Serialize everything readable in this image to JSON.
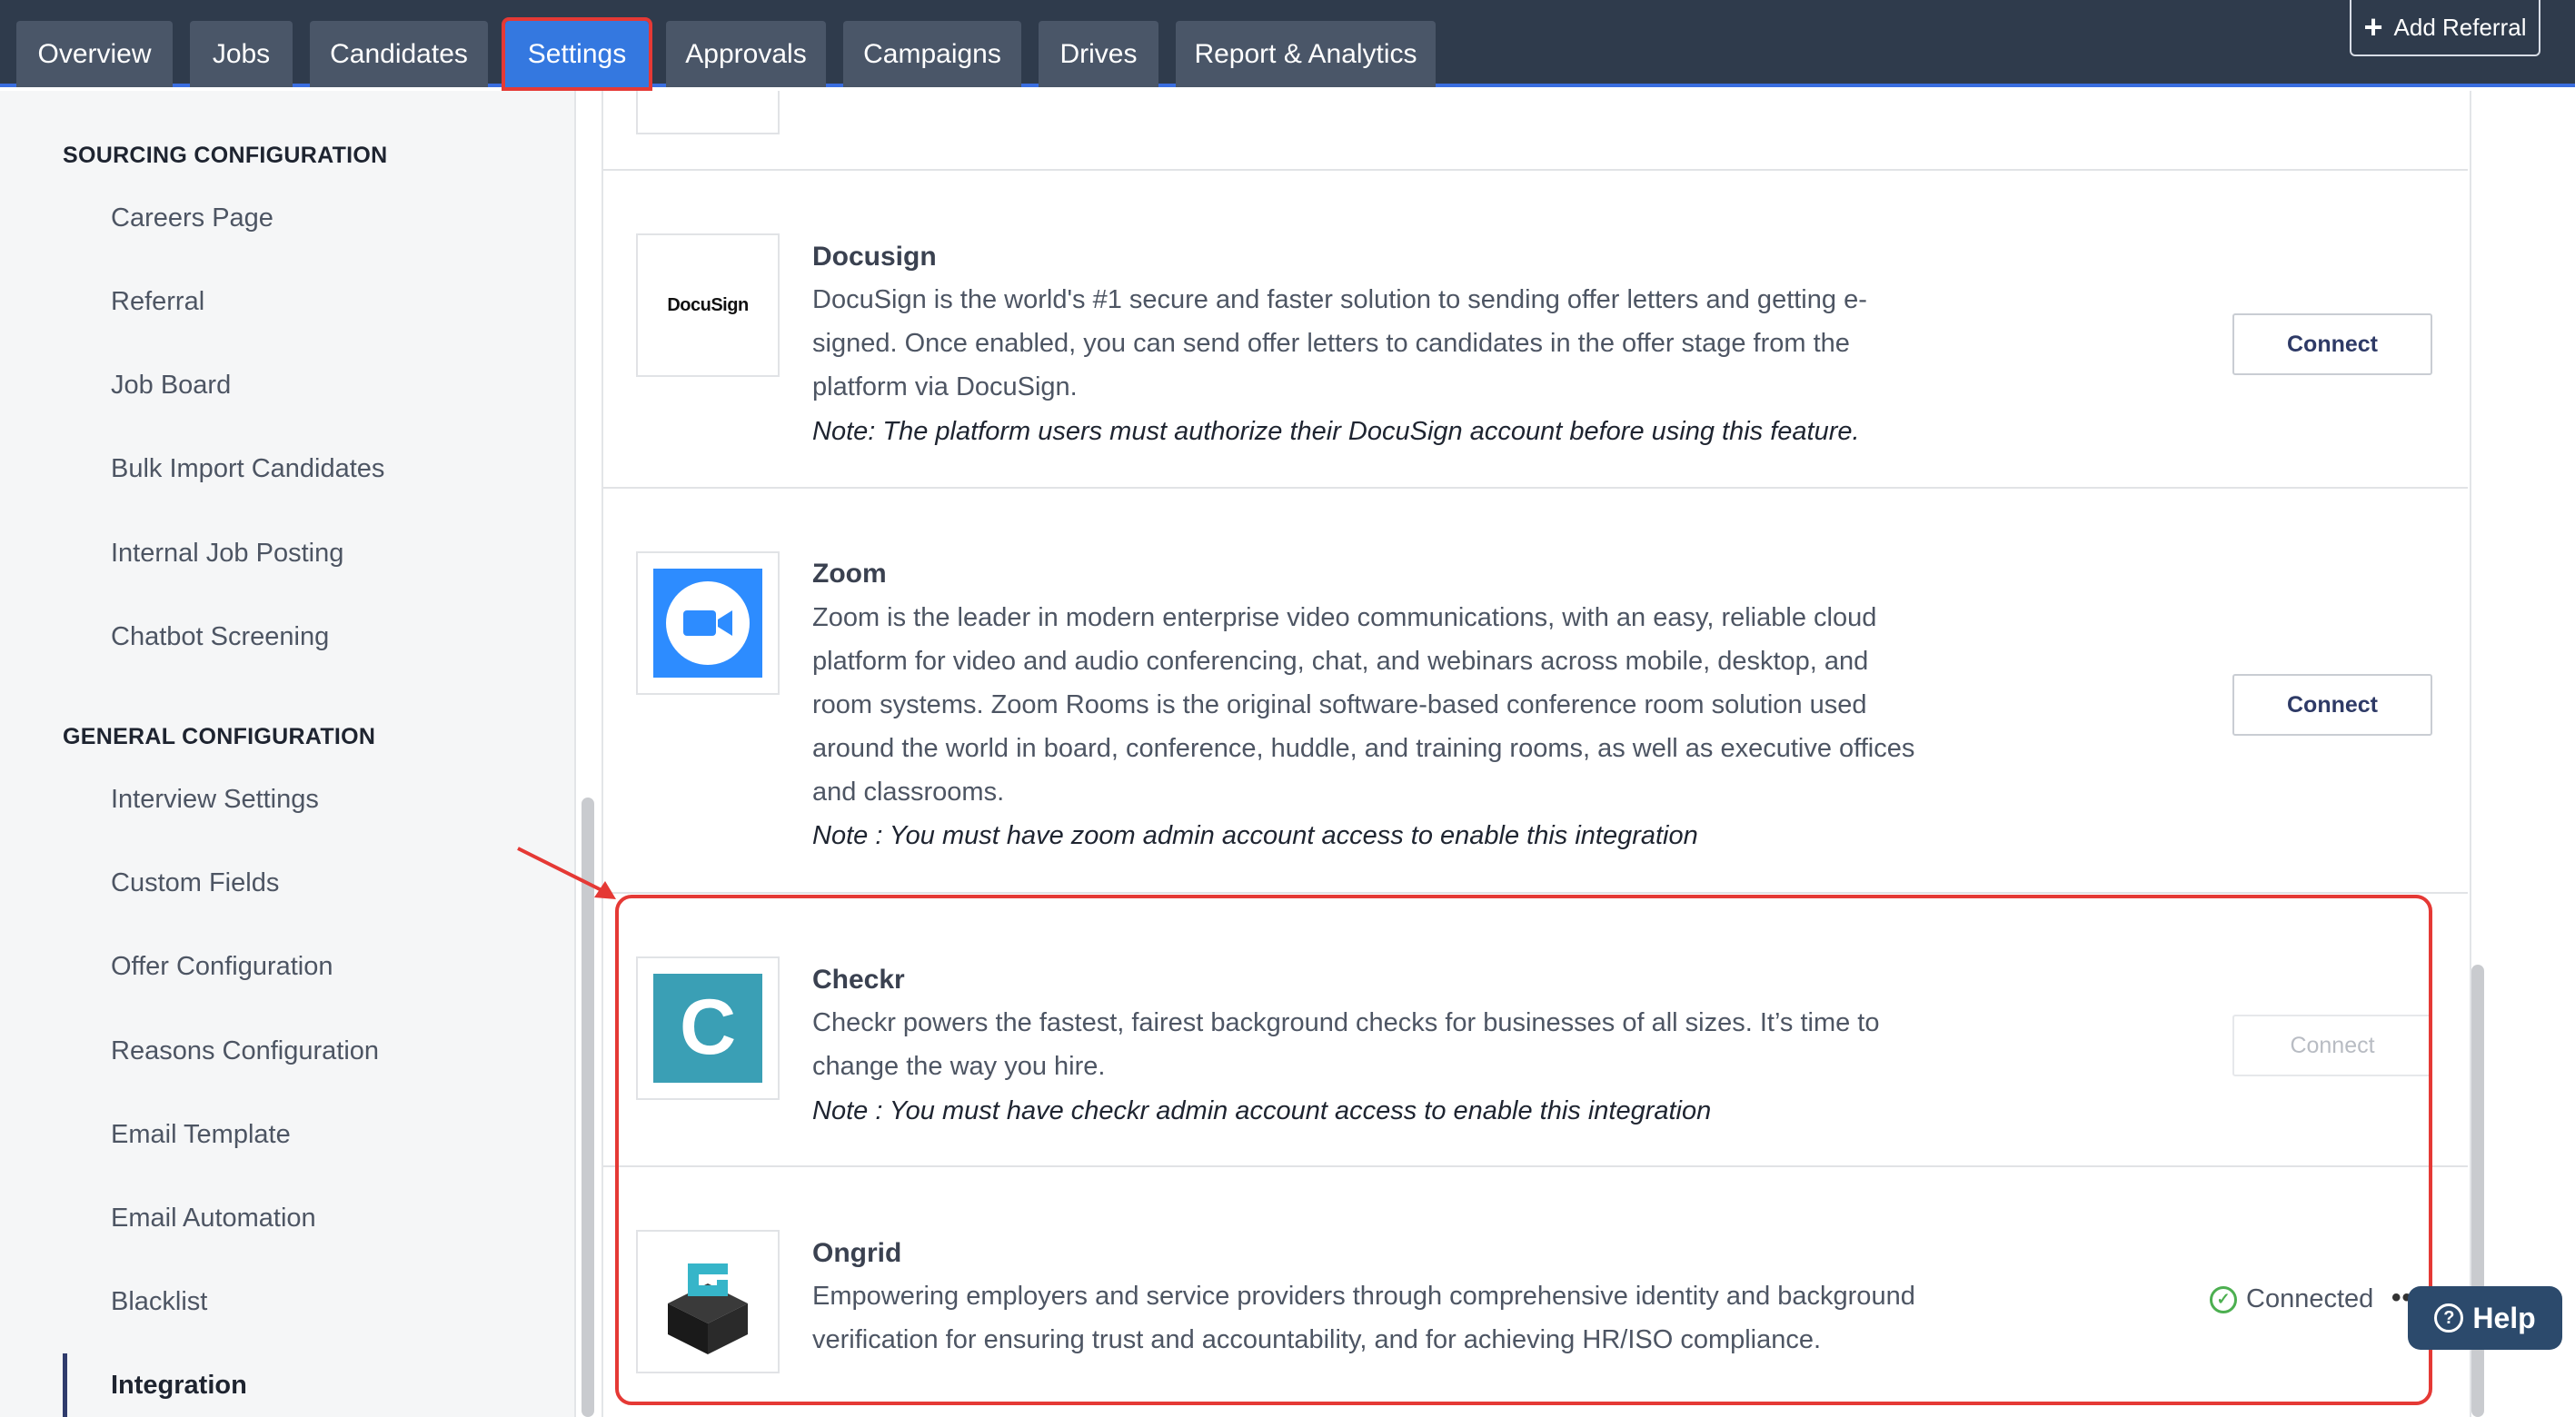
{
  "nav": {
    "tabs": [
      "Overview",
      "Jobs",
      "Candidates",
      "Settings",
      "Approvals",
      "Campaigns",
      "Drives",
      "Report & Analytics"
    ],
    "active_tab": "Settings",
    "add_referral_label": "Add Referral"
  },
  "sidebar": {
    "sourcing_title": "SOURCING CONFIGURATION",
    "sourcing_items": [
      "Careers Page",
      "Referral",
      "Job Board",
      "Bulk Import Candidates",
      "Internal Job Posting",
      "Chatbot Screening"
    ],
    "general_title": "GENERAL CONFIGURATION",
    "general_items": [
      "Interview Settings",
      "Custom Fields",
      "Offer Configuration",
      "Reasons Configuration",
      "Email Template",
      "Email Automation",
      "Blacklist",
      "Integration"
    ],
    "active_item": "Integration"
  },
  "integrations": {
    "docusign": {
      "logo_text": "DocuSign",
      "title": "Docusign",
      "desc_lines": [
        "DocuSign is the world's #1 secure and faster solution to sending offer letters and getting e-",
        "signed. Once enabled, you can send offer letters to candidates in the offer stage from the",
        "platform via DocuSign."
      ],
      "note": "Note: The platform users must authorize their DocuSign account before using this feature.",
      "action": "Connect"
    },
    "zoom": {
      "title": "Zoom",
      "desc_lines": [
        "Zoom is the leader in modern enterprise video communications, with an easy, reliable cloud",
        "platform for video and audio conferencing, chat, and webinars across mobile, desktop, and",
        "room systems. Zoom Rooms is the original software-based conference room solution used",
        "around the world in board, conference, huddle, and training rooms, as well as executive offices",
        "and classrooms."
      ],
      "note": "Note : You must have zoom admin account access to enable this integration",
      "action": "Connect"
    },
    "checkr": {
      "logo_letter": "C",
      "title": "Checkr",
      "desc_lines": [
        "Checkr powers the fastest, fairest background checks for businesses of all sizes. It’s time to",
        "change the way you hire."
      ],
      "note": "Note : You must have checkr admin account access to enable this integration",
      "action": "Connect"
    },
    "ongrid": {
      "title": "Ongrid",
      "desc_lines": [
        "Empowering employers and service providers through comprehensive identity and background",
        "verification for ensuring trust and accountability, and for achieving HR/ISO compliance."
      ],
      "status": "Connected",
      "more": "••"
    }
  },
  "help_label": "Help",
  "colors": {
    "topbar": "#2f3b4c",
    "active_tab": "#3478e0",
    "highlight": "#e53935",
    "zoom_blue": "#2d8cff",
    "checkr_teal": "#3a9fb5"
  }
}
